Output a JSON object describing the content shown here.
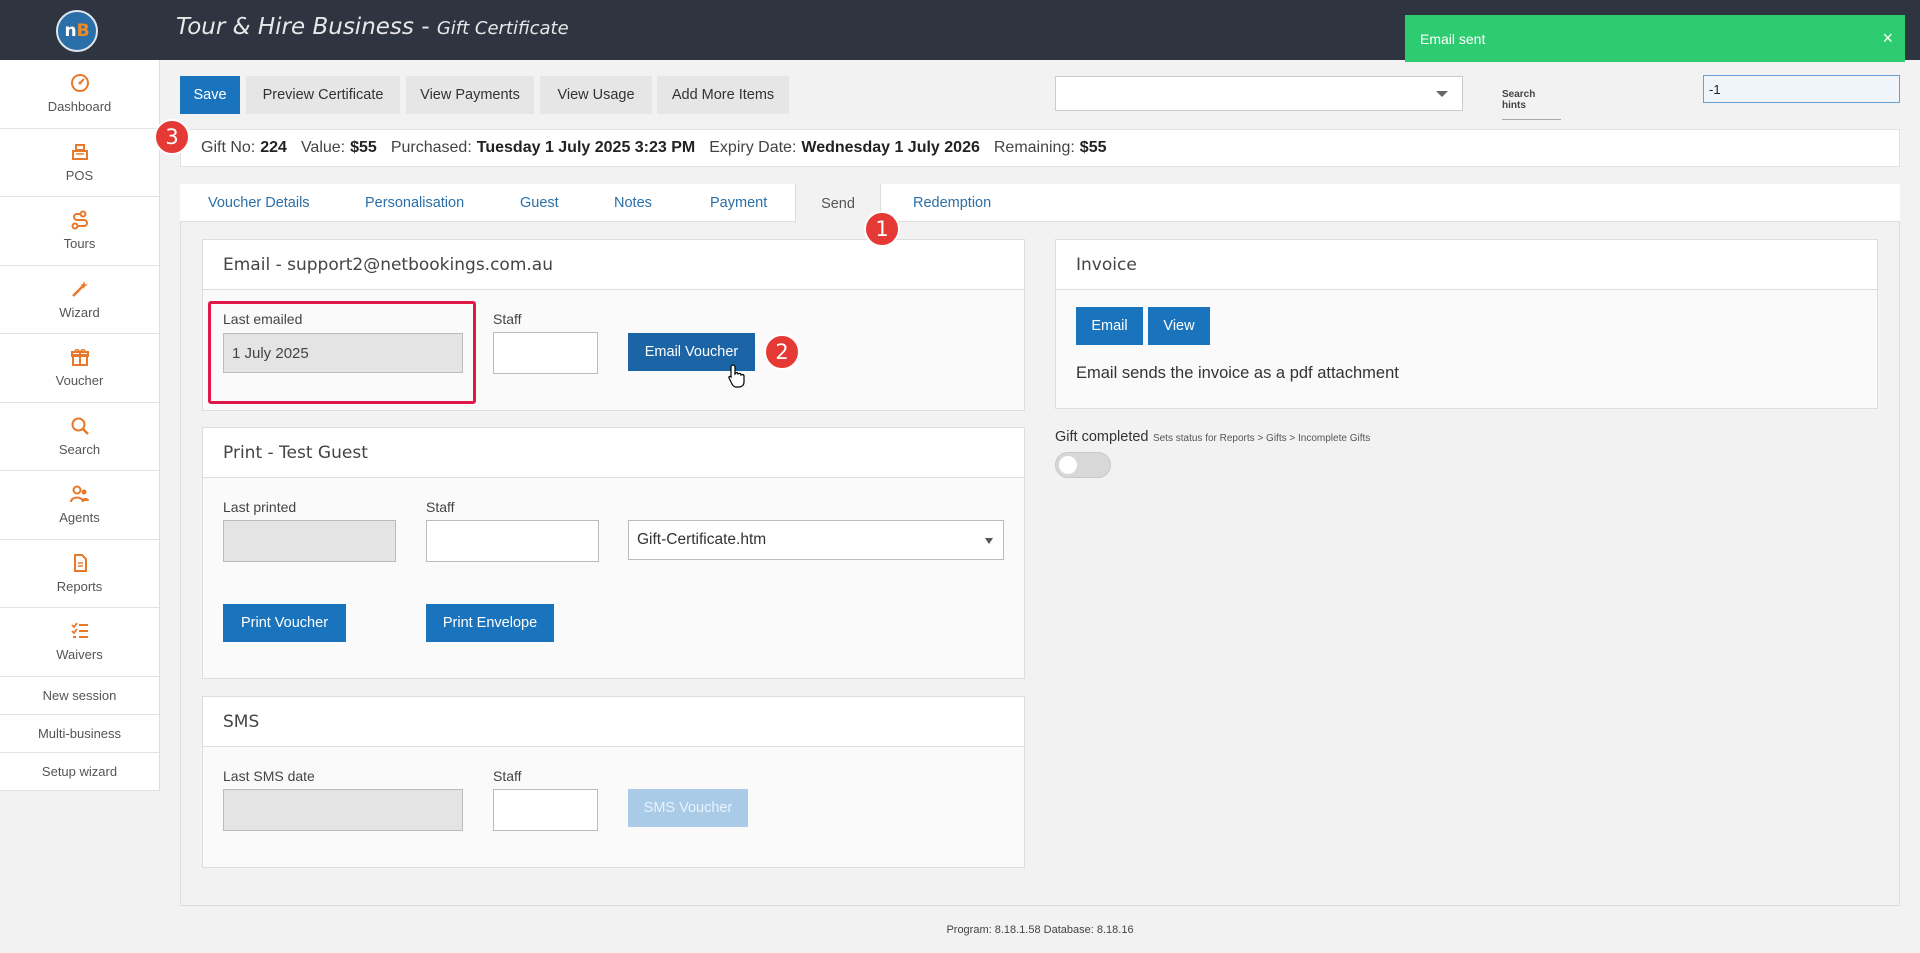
{
  "header": {
    "logo_text_n": "n",
    "logo_text_b": "B",
    "title": "Tour & Hire Business -",
    "subtitle": "Gift Certificate"
  },
  "toast": {
    "message": "Email sent",
    "close": "×"
  },
  "sidebar": {
    "items": [
      {
        "label": "Dashboard",
        "icon": "dashboard-icon"
      },
      {
        "label": "POS",
        "icon": "register-icon"
      },
      {
        "label": "Tours",
        "icon": "route-icon"
      },
      {
        "label": "Wizard",
        "icon": "magic-wand-icon"
      },
      {
        "label": "Voucher",
        "icon": "gift-icon"
      },
      {
        "label": "Search",
        "icon": "search-icon"
      },
      {
        "label": "Agents",
        "icon": "users-icon"
      },
      {
        "label": "Reports",
        "icon": "document-icon"
      },
      {
        "label": "Waivers",
        "icon": "checklist-icon"
      }
    ],
    "links": [
      "New session",
      "Multi-business",
      "Setup wizard"
    ],
    "icon_color": "#e8782a"
  },
  "toolbar": {
    "save": "Save",
    "preview": "Preview Certificate",
    "payments": "View Payments",
    "usage": "View Usage",
    "add_items": "Add More Items",
    "search_hints": "Search hints",
    "search_value": "-1"
  },
  "info": {
    "gift_no_label": "Gift No:",
    "gift_no": "224",
    "value_label": "Value:",
    "value": "$55",
    "purchased_label": "Purchased:",
    "purchased": "Tuesday 1 July 2025 3:23 PM",
    "expiry_label": "Expiry Date:",
    "expiry": "Wednesday 1 July 2026",
    "remaining_label": "Remaining:",
    "remaining": "$55"
  },
  "tabs": [
    "Voucher Details",
    "Personalisation",
    "Guest",
    "Notes",
    "Payment",
    "Send",
    "Redemption"
  ],
  "active_tab": "Send",
  "badges": [
    "1",
    "2",
    "3"
  ],
  "email_panel": {
    "title": "Email - support2@netbookings.com.au",
    "last_emailed_label": "Last emailed",
    "last_emailed": "1 July 2025",
    "staff_label": "Staff",
    "staff": "",
    "button": "Email Voucher"
  },
  "print_panel": {
    "title": "Print - Test Guest",
    "last_printed_label": "Last printed",
    "last_printed": "",
    "staff_label": "Staff",
    "template": "Gift-Certificate.htm",
    "print_voucher": "Print Voucher",
    "print_envelope": "Print Envelope"
  },
  "sms_panel": {
    "title": "SMS",
    "last_sms_label": "Last SMS date",
    "last_sms": "",
    "staff_label": "Staff",
    "button": "SMS Voucher"
  },
  "invoice_panel": {
    "title": "Invoice",
    "email": "Email",
    "view": "View",
    "note": "Email sends the invoice as a pdf attachment"
  },
  "gift_completed": {
    "label": "Gift completed",
    "hint": "Sets status for Reports > Gifts > Incomplete Gifts",
    "checked": false
  },
  "footer": "Program: 8.18.1.58 Database: 8.18.16",
  "colors": {
    "primary": "#1a74bd",
    "toast": "#2ecc71",
    "badge": "#e53935",
    "highlight": "#e0184a"
  }
}
